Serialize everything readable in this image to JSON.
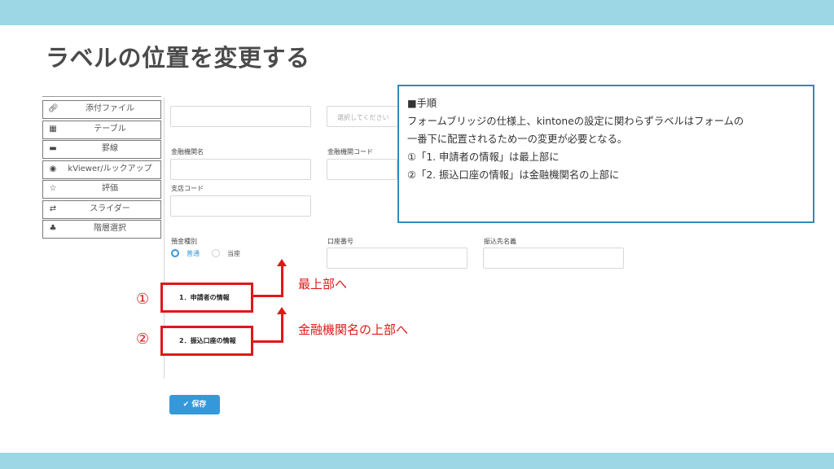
{
  "slide": {
    "title": "ラベルの位置を変更する"
  },
  "palette": {
    "items": [
      {
        "icon": "paperclip-icon",
        "glyph": "🔗︎",
        "label": "添付ファイル"
      },
      {
        "icon": "table-icon",
        "glyph": "▦",
        "label": "テーブル"
      },
      {
        "icon": "line-icon",
        "glyph": "▬",
        "label": "罫線"
      },
      {
        "icon": "eye-icon",
        "glyph": "◉",
        "label": "kViewer/ルックアップ"
      },
      {
        "icon": "star-icon",
        "glyph": "☆",
        "label": "評価"
      },
      {
        "icon": "swap-icon",
        "glyph": "⇄",
        "label": "スライダー"
      },
      {
        "icon": "hierarchy-icon",
        "glyph": "♣",
        "label": "階層選択"
      }
    ]
  },
  "form": {
    "select_placeholder": "選択してください",
    "bank_name_label": "金融機関名",
    "bank_code_label": "金融機関コード",
    "branch_code_label": "支店コード",
    "deposit_type_label": "預金種別",
    "deposit_options": [
      "普通",
      "当座"
    ],
    "account_number_label": "口座番号",
    "transfer_name_label": "振込先名義",
    "label_field_1": "1．申請者の情報",
    "label_field_2": "2．振込口座の情報",
    "save_label": "保存"
  },
  "callouts": {
    "num1": "①",
    "num2": "②",
    "note1": "最上部へ",
    "note2": "金融機関名の上部へ"
  },
  "note": {
    "heading": "■手順",
    "line1": "フォームブリッジの仕様上、kintoneの設定に関わらずラベルはフォームの",
    "line2": "一番下に配置されるため一の変更が必要となる。",
    "line3": "①「1. 申請者の情報」は最上部に",
    "line4": "②「2. 振込口座の情報」は金融機関名の上部に"
  },
  "colors": {
    "band": "#9dd7e5",
    "accent_red": "#e01818",
    "primary_blue": "#3498db",
    "note_border": "#2e8bc0"
  }
}
